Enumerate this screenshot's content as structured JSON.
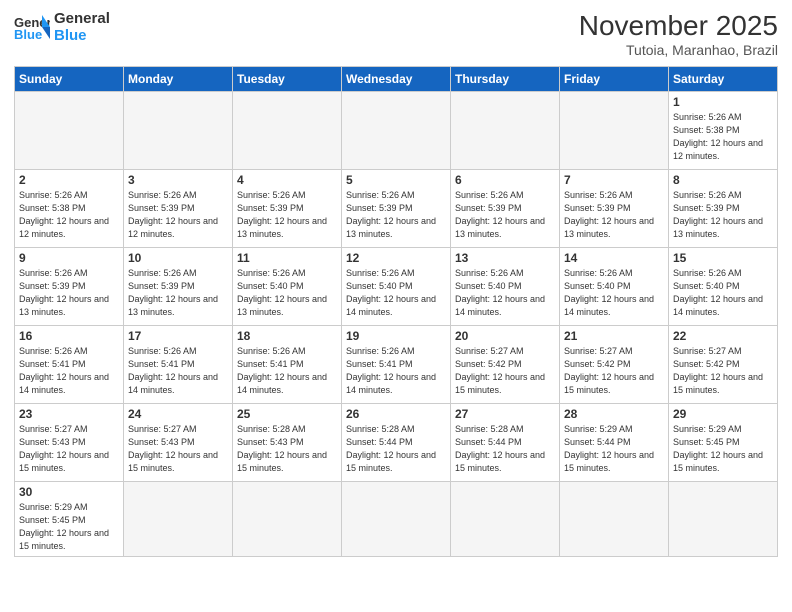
{
  "logo": {
    "general": "General",
    "blue": "Blue"
  },
  "header": {
    "month": "November 2025",
    "location": "Tutoia, Maranhao, Brazil"
  },
  "weekdays": [
    "Sunday",
    "Monday",
    "Tuesday",
    "Wednesday",
    "Thursday",
    "Friday",
    "Saturday"
  ],
  "weeks": [
    [
      {
        "day": "",
        "info": ""
      },
      {
        "day": "",
        "info": ""
      },
      {
        "day": "",
        "info": ""
      },
      {
        "day": "",
        "info": ""
      },
      {
        "day": "",
        "info": ""
      },
      {
        "day": "",
        "info": ""
      },
      {
        "day": "1",
        "info": "Sunrise: 5:26 AM\nSunset: 5:38 PM\nDaylight: 12 hours and 12 minutes."
      }
    ],
    [
      {
        "day": "2",
        "info": "Sunrise: 5:26 AM\nSunset: 5:38 PM\nDaylight: 12 hours and 12 minutes."
      },
      {
        "day": "3",
        "info": "Sunrise: 5:26 AM\nSunset: 5:39 PM\nDaylight: 12 hours and 12 minutes."
      },
      {
        "day": "4",
        "info": "Sunrise: 5:26 AM\nSunset: 5:39 PM\nDaylight: 12 hours and 13 minutes."
      },
      {
        "day": "5",
        "info": "Sunrise: 5:26 AM\nSunset: 5:39 PM\nDaylight: 12 hours and 13 minutes."
      },
      {
        "day": "6",
        "info": "Sunrise: 5:26 AM\nSunset: 5:39 PM\nDaylight: 12 hours and 13 minutes."
      },
      {
        "day": "7",
        "info": "Sunrise: 5:26 AM\nSunset: 5:39 PM\nDaylight: 12 hours and 13 minutes."
      },
      {
        "day": "8",
        "info": "Sunrise: 5:26 AM\nSunset: 5:39 PM\nDaylight: 12 hours and 13 minutes."
      }
    ],
    [
      {
        "day": "9",
        "info": "Sunrise: 5:26 AM\nSunset: 5:39 PM\nDaylight: 12 hours and 13 minutes."
      },
      {
        "day": "10",
        "info": "Sunrise: 5:26 AM\nSunset: 5:39 PM\nDaylight: 12 hours and 13 minutes."
      },
      {
        "day": "11",
        "info": "Sunrise: 5:26 AM\nSunset: 5:40 PM\nDaylight: 12 hours and 13 minutes."
      },
      {
        "day": "12",
        "info": "Sunrise: 5:26 AM\nSunset: 5:40 PM\nDaylight: 12 hours and 14 minutes."
      },
      {
        "day": "13",
        "info": "Sunrise: 5:26 AM\nSunset: 5:40 PM\nDaylight: 12 hours and 14 minutes."
      },
      {
        "day": "14",
        "info": "Sunrise: 5:26 AM\nSunset: 5:40 PM\nDaylight: 12 hours and 14 minutes."
      },
      {
        "day": "15",
        "info": "Sunrise: 5:26 AM\nSunset: 5:40 PM\nDaylight: 12 hours and 14 minutes."
      }
    ],
    [
      {
        "day": "16",
        "info": "Sunrise: 5:26 AM\nSunset: 5:41 PM\nDaylight: 12 hours and 14 minutes."
      },
      {
        "day": "17",
        "info": "Sunrise: 5:26 AM\nSunset: 5:41 PM\nDaylight: 12 hours and 14 minutes."
      },
      {
        "day": "18",
        "info": "Sunrise: 5:26 AM\nSunset: 5:41 PM\nDaylight: 12 hours and 14 minutes."
      },
      {
        "day": "19",
        "info": "Sunrise: 5:26 AM\nSunset: 5:41 PM\nDaylight: 12 hours and 14 minutes."
      },
      {
        "day": "20",
        "info": "Sunrise: 5:27 AM\nSunset: 5:42 PM\nDaylight: 12 hours and 15 minutes."
      },
      {
        "day": "21",
        "info": "Sunrise: 5:27 AM\nSunset: 5:42 PM\nDaylight: 12 hours and 15 minutes."
      },
      {
        "day": "22",
        "info": "Sunrise: 5:27 AM\nSunset: 5:42 PM\nDaylight: 12 hours and 15 minutes."
      }
    ],
    [
      {
        "day": "23",
        "info": "Sunrise: 5:27 AM\nSunset: 5:43 PM\nDaylight: 12 hours and 15 minutes."
      },
      {
        "day": "24",
        "info": "Sunrise: 5:27 AM\nSunset: 5:43 PM\nDaylight: 12 hours and 15 minutes."
      },
      {
        "day": "25",
        "info": "Sunrise: 5:28 AM\nSunset: 5:43 PM\nDaylight: 12 hours and 15 minutes."
      },
      {
        "day": "26",
        "info": "Sunrise: 5:28 AM\nSunset: 5:44 PM\nDaylight: 12 hours and 15 minutes."
      },
      {
        "day": "27",
        "info": "Sunrise: 5:28 AM\nSunset: 5:44 PM\nDaylight: 12 hours and 15 minutes."
      },
      {
        "day": "28",
        "info": "Sunrise: 5:29 AM\nSunset: 5:44 PM\nDaylight: 12 hours and 15 minutes."
      },
      {
        "day": "29",
        "info": "Sunrise: 5:29 AM\nSunset: 5:45 PM\nDaylight: 12 hours and 15 minutes."
      }
    ],
    [
      {
        "day": "30",
        "info": "Sunrise: 5:29 AM\nSunset: 5:45 PM\nDaylight: 12 hours and 15 minutes."
      },
      {
        "day": "",
        "info": ""
      },
      {
        "day": "",
        "info": ""
      },
      {
        "day": "",
        "info": ""
      },
      {
        "day": "",
        "info": ""
      },
      {
        "day": "",
        "info": ""
      },
      {
        "day": "",
        "info": ""
      }
    ]
  ]
}
